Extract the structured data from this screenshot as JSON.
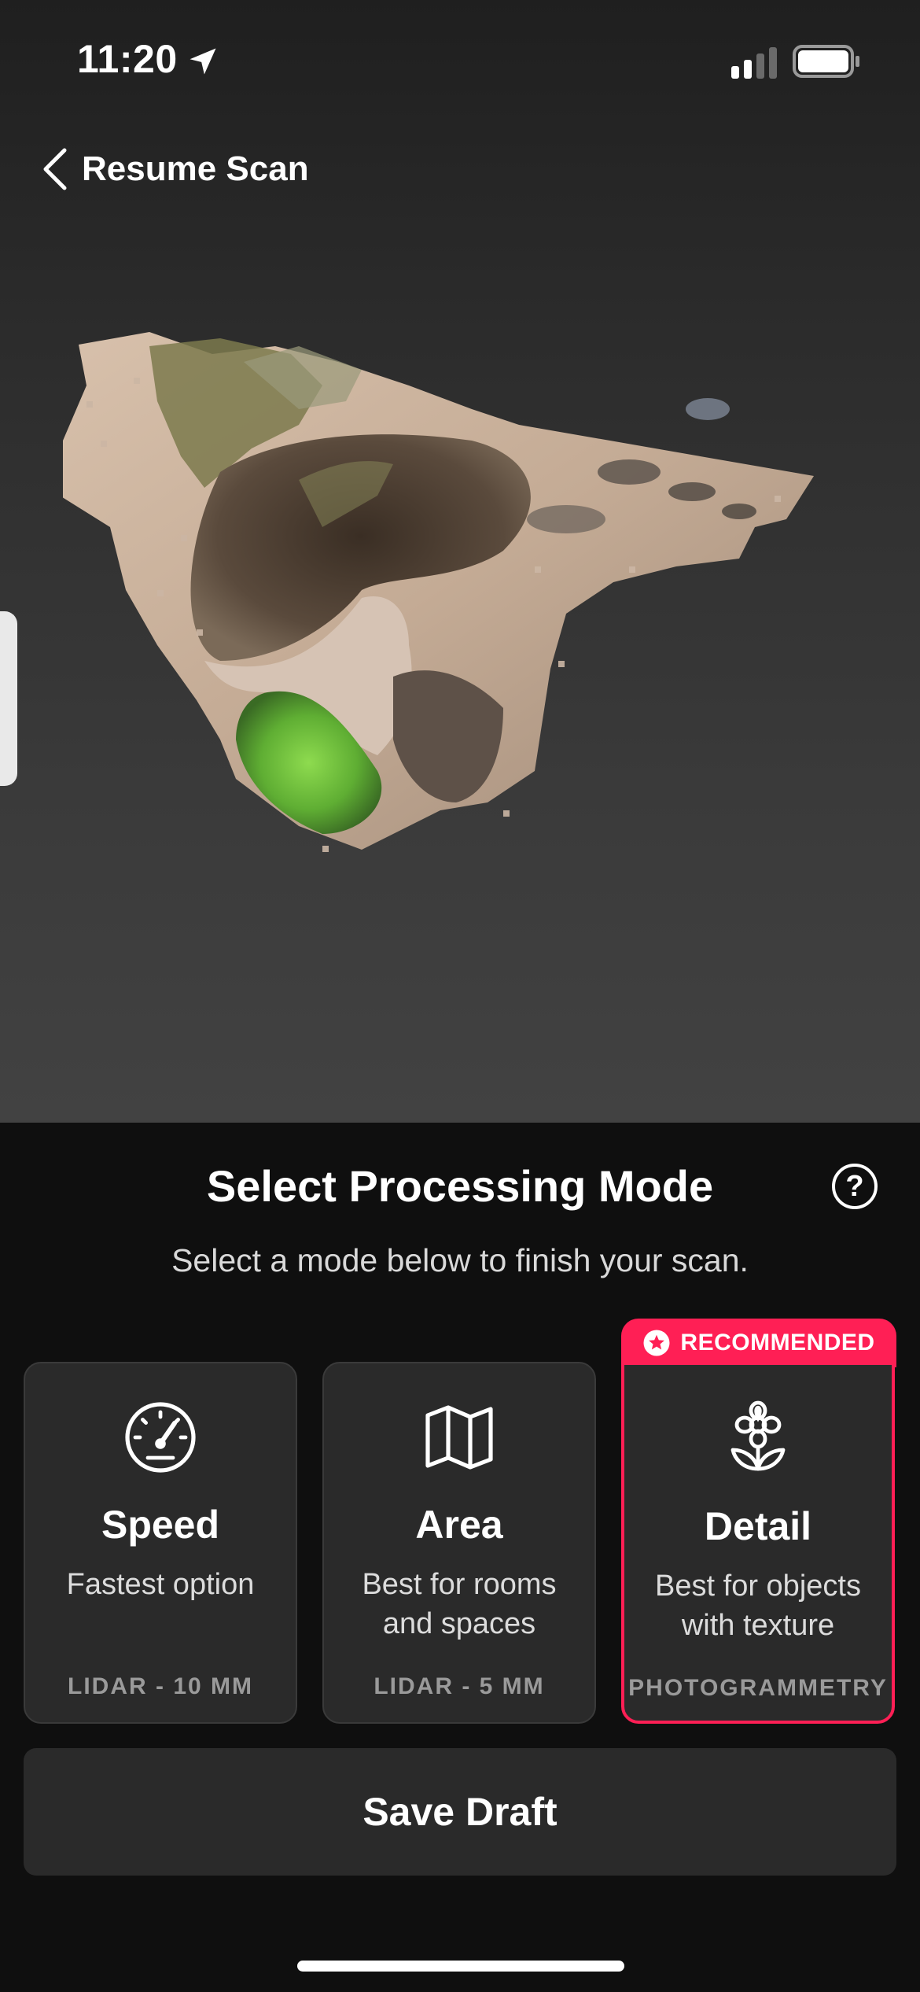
{
  "status_bar": {
    "time": "11:20",
    "location_icon": "location-arrow-icon",
    "signal_icon": "cellular-signal-icon",
    "battery_icon": "battery-icon"
  },
  "nav": {
    "back_icon": "chevron-left-icon",
    "back_label": "Resume Scan"
  },
  "viewport": {
    "model_icon": "scan-point-cloud-model"
  },
  "sheet": {
    "title": "Select Processing Mode",
    "help_label": "?",
    "subtitle": "Select a mode below to finish your scan.",
    "modes": [
      {
        "icon": "speedometer-icon",
        "name": "Speed",
        "description": "Fastest option",
        "technology": "LIDAR - 10 MM",
        "selected": false
      },
      {
        "icon": "map-icon",
        "name": "Area",
        "description": "Best for rooms and spaces",
        "technology": "LIDAR - 5 MM",
        "selected": false
      },
      {
        "icon": "flower-icon",
        "name": "Detail",
        "description": "Best for objects with texture",
        "technology": "PHOTOGRAMMETRY",
        "selected": true
      }
    ],
    "recommended_badge": {
      "icon": "star-icon",
      "label": "RECOMMENDED"
    },
    "save_draft_label": "Save Draft"
  },
  "colors": {
    "accent": "#ff1f55",
    "card_background": "#2a2a2a",
    "sheet_background": "#0f0f0f"
  }
}
